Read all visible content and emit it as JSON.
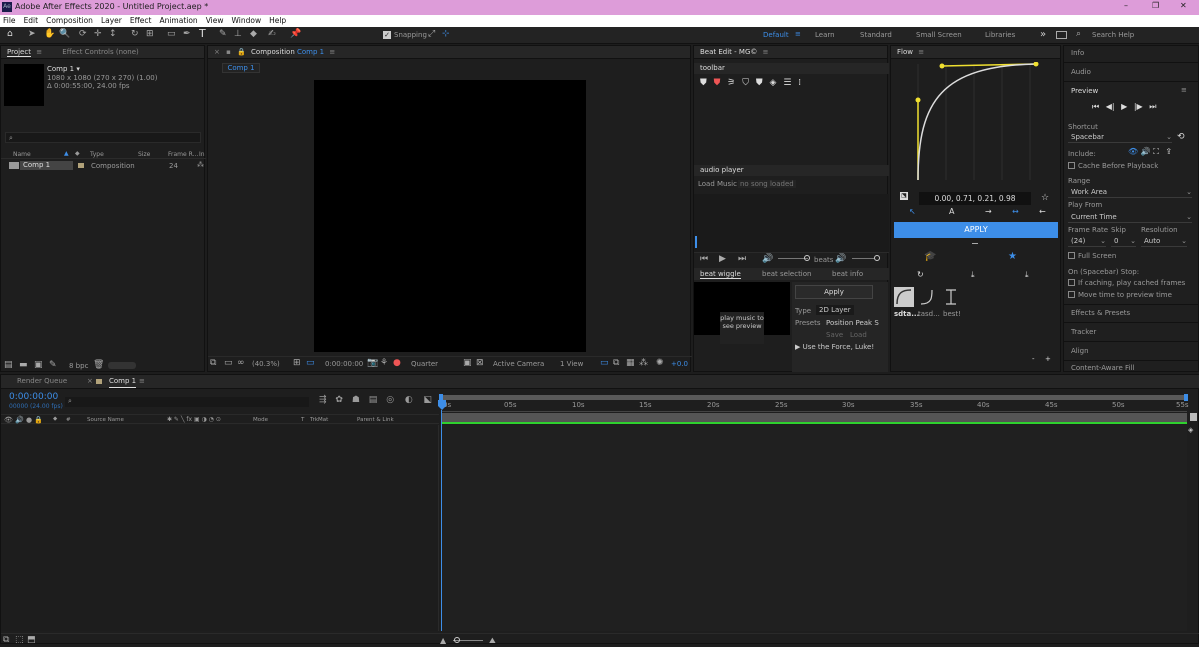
{
  "titlebar": {
    "app_icon": "Ae",
    "title": "Adobe After Effects 2020 - Untitled Project.aep *",
    "minimize": "–",
    "maximize": "❐",
    "close": "✕"
  },
  "menu": [
    "File",
    "Edit",
    "Composition",
    "Layer",
    "Effect",
    "Animation",
    "View",
    "Window",
    "Help"
  ],
  "toolbar": {
    "snapping": "Snapping",
    "workspaces": [
      "Default",
      "Learn",
      "Standard",
      "Small Screen",
      "Libraries"
    ],
    "more": "»",
    "search_placeholder": "Search Help"
  },
  "project": {
    "tab_project": "Project",
    "tab_effect_controls": "Effect Controls (none)",
    "comp_name": "Comp 1 ▾",
    "comp_size": "1080 x 1080  (270 x 270) (1.00)",
    "comp_duration": "Δ 0:00:55:00, 24.00 fps",
    "columns": [
      "Name",
      "Type",
      "Size",
      "Frame R...",
      "In"
    ],
    "row": {
      "name": "Comp 1",
      "type": "Composition",
      "frame_rate": "24"
    },
    "bpc": "8 bpc"
  },
  "composition": {
    "tab_prefix": "Composition",
    "tab_name": "Comp 1",
    "breadcrumb": "Comp 1",
    "zoom": "(40.3%)",
    "timecode": "0:00:00:00",
    "resolution": "Quarter",
    "camera": "Active Camera",
    "views": "1 View",
    "exposure": "+0.0"
  },
  "beat_edit": {
    "title": "Beat Edit - MG©",
    "toolbar_label": "toolbar",
    "audio_label": "audio player",
    "load_music": "Load Music",
    "no_song": "no song loaded",
    "beats": "beats",
    "tabs": [
      "beat wiggle",
      "beat selection",
      "beat info"
    ],
    "preview": "play music to see preview",
    "apply": "Apply",
    "type_label": "Type",
    "type_value": "2D Layer",
    "presets_label": "Presets",
    "presets_value": "Position Peak S",
    "save": "Save",
    "load": "Load",
    "force": "▶ Use the Force, Luke!"
  },
  "flow": {
    "title": "Flow",
    "values": "0.00, 0.71, 0.21, 0.98",
    "apply": "APPLY",
    "presets": [
      "sdta...",
      "tasd...",
      "best!"
    ],
    "minus": "-",
    "plus": "+"
  },
  "right_panel": {
    "info": "Info",
    "audio": "Audio",
    "preview": "Preview",
    "shortcut": "Shortcut",
    "shortcut_value": "Spacebar",
    "include": "Include:",
    "cache": "Cache Before Playback",
    "range": "Range",
    "range_value": "Work Area",
    "play_from": "Play From",
    "play_from_value": "Current Time",
    "frame_rate": "Frame Rate",
    "skip": "Skip",
    "resolution": "Resolution",
    "frame_rate_value": "(24)",
    "skip_value": "0",
    "resolution_value": "Auto",
    "full_screen": "Full Screen",
    "on_stop": "On (Spacebar) Stop:",
    "if_caching": "If caching, play cached frames",
    "move_time": "Move time to preview time",
    "effects": "Effects & Presets",
    "tracker": "Tracker",
    "align": "Align",
    "content_aware": "Content-Aware Fill"
  },
  "timeline": {
    "tab_render": "Render Queue",
    "tab_comp": "Comp 1",
    "timecode": "0:00:00:00",
    "frames": "00000 (24.00 fps)",
    "cols": [
      "#",
      "Source Name",
      "Mode",
      "T",
      "TrkMat",
      "Parent & Link"
    ],
    "ruler": [
      "0s",
      "05s",
      "10s",
      "15s",
      "20s",
      "25s",
      "30s",
      "35s",
      "40s",
      "45s",
      "50s",
      "55s"
    ]
  },
  "colors": {
    "title_bg": "#dd9cd9",
    "accent": "#3d8ee8",
    "apply_bg": "#3d8ee8",
    "curve_point": "#f0e030",
    "timeline_bar": "#2fd12f"
  }
}
